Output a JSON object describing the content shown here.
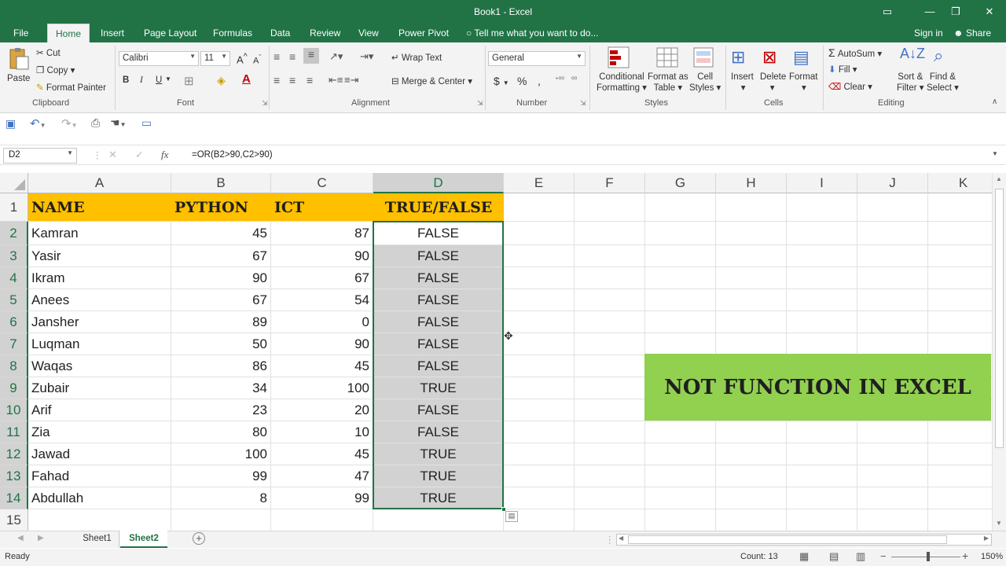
{
  "window": {
    "title": "Book1 - Excel"
  },
  "tabs": [
    {
      "label": "File"
    },
    {
      "label": "Home"
    },
    {
      "label": "Insert"
    },
    {
      "label": "Page Layout"
    },
    {
      "label": "Formulas"
    },
    {
      "label": "Data"
    },
    {
      "label": "Review"
    },
    {
      "label": "View"
    },
    {
      "label": "Power Pivot"
    },
    {
      "label": "Tell me what you want to do..."
    },
    {
      "label": "Sign in"
    },
    {
      "label": "Share"
    }
  ],
  "ribbon": {
    "clipboard": {
      "paste": "Paste",
      "cut": "Cut",
      "copy": "Copy",
      "format_painter": "Format Painter",
      "group": "Clipboard"
    },
    "font": {
      "name": "Calibri",
      "size": "11",
      "group": "Font",
      "bold": "B",
      "italic": "I",
      "underline": "U",
      "grow": "A",
      "shrink": "A"
    },
    "alignment": {
      "wrap": "Wrap Text",
      "merge": "Merge & Center",
      "group": "Alignment"
    },
    "number": {
      "format": "General",
      "currency": "$",
      "percent": "%",
      "comma": ",",
      "group": "Number"
    },
    "styles": {
      "conditional": "Conditional",
      "conditional2": "Formatting",
      "format_as": "Format as",
      "format_as2": "Table",
      "cell": "Cell",
      "cell2": "Styles",
      "group": "Styles"
    },
    "cells": {
      "insert": "Insert",
      "delete": "Delete",
      "format": "Format",
      "group": "Cells"
    },
    "editing": {
      "autosum": "AutoSum",
      "fill": "Fill",
      "clear": "Clear",
      "sort": "Sort &",
      "sort2": "Filter",
      "find": "Find &",
      "find2": "Select",
      "group": "Editing"
    }
  },
  "formula_bar": {
    "name_box": "D2",
    "fx": "fx",
    "formula": "=OR(B2>90,C2>90)"
  },
  "columns": [
    "A",
    "B",
    "C",
    "D",
    "E",
    "F",
    "G",
    "H",
    "I",
    "J",
    "K"
  ],
  "rows": [
    "1",
    "2",
    "3",
    "4",
    "5",
    "6",
    "7",
    "8",
    "9",
    "10",
    "11",
    "12",
    "13",
    "14",
    "15"
  ],
  "headers": {
    "name": "NAME",
    "python": "PYTHON",
    "ict": "ICT",
    "result": "TRUE/FALSE"
  },
  "table": [
    {
      "name": "Kamran",
      "python": "45",
      "ict": "87",
      "result": "FALSE"
    },
    {
      "name": "Yasir",
      "python": "67",
      "ict": "90",
      "result": "FALSE"
    },
    {
      "name": "Ikram",
      "python": "90",
      "ict": "67",
      "result": "FALSE"
    },
    {
      "name": "Anees",
      "python": "67",
      "ict": "54",
      "result": "FALSE"
    },
    {
      "name": "Jansher",
      "python": "89",
      "ict": "0",
      "result": "FALSE"
    },
    {
      "name": "Luqman",
      "python": "50",
      "ict": "90",
      "result": "FALSE"
    },
    {
      "name": "Waqas",
      "python": "86",
      "ict": "45",
      "result": "FALSE"
    },
    {
      "name": "Zubair",
      "python": "34",
      "ict": "100",
      "result": "TRUE"
    },
    {
      "name": "Arif",
      "python": "23",
      "ict": "20",
      "result": "FALSE"
    },
    {
      "name": "Zia",
      "python": "80",
      "ict": "10",
      "result": "FALSE"
    },
    {
      "name": "Jawad",
      "python": "100",
      "ict": "45",
      "result": "TRUE"
    },
    {
      "name": "Fahad",
      "python": "99",
      "ict": "47",
      "result": "TRUE"
    },
    {
      "name": "Abdullah",
      "python": "8",
      "ict": "99",
      "result": "TRUE"
    }
  ],
  "banner": {
    "text": "NOT FUNCTION IN EXCEL",
    "color": "#92d050"
  },
  "sheets": [
    {
      "label": "Sheet1"
    },
    {
      "label": "Sheet2",
      "active": true
    }
  ],
  "status": {
    "ready": "Ready",
    "count": "Count: 13",
    "zoom": "150%"
  },
  "colors": {
    "accent": "#217346",
    "header_fill": "#ffc000",
    "selection": "#d2d2d2"
  }
}
